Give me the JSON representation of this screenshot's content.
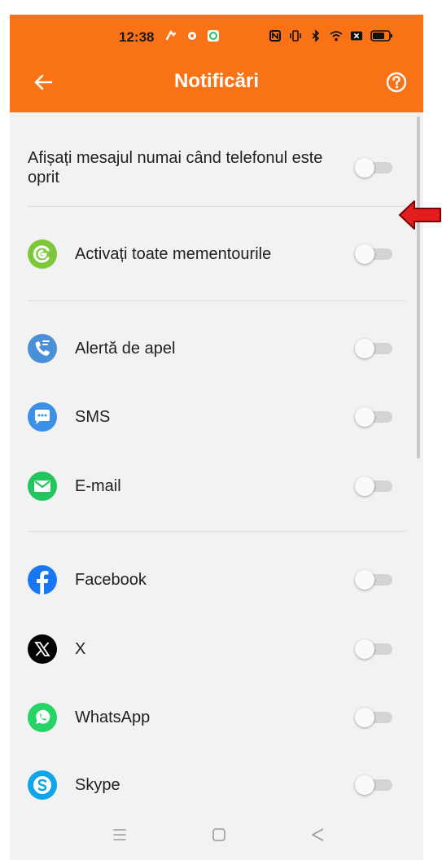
{
  "status_bar": {
    "time": "12:38"
  },
  "toolbar": {
    "title": "Notificări"
  },
  "settings": {
    "screen_off_label": "Afișați mesajul numai când telefonul este oprit",
    "all_reminders_label": "Activați toate mementourile",
    "call_alert_label": "Alertă de apel",
    "sms_label": "SMS",
    "email_label": "E-mail",
    "facebook_label": "Facebook",
    "x_label": "X",
    "whatsapp_label": "WhatsApp",
    "skype_label": "Skype"
  },
  "toggles": {
    "screen_off": false,
    "all_reminders": false,
    "call_alert": false,
    "sms": false,
    "email": false,
    "facebook": false,
    "x": false,
    "whatsapp": false,
    "skype": false
  },
  "colors": {
    "appbar": "#f97316",
    "reminder_icon": "#7cc83a",
    "call_icon": "#4a90d9",
    "sms_icon": "#3d8fe8",
    "email_icon": "#22c55e",
    "facebook_icon": "#1877f2",
    "x_icon": "#000000",
    "whatsapp_icon": "#25d366",
    "skype_icon": "#0ea5e9",
    "annotation_arrow": "#e11d1d"
  },
  "icons": [
    "back-arrow-icon",
    "help-icon",
    "reminder-icon",
    "phone-call-icon",
    "sms-bubble-icon",
    "email-envelope-icon",
    "facebook-icon",
    "x-logo-icon",
    "whatsapp-icon",
    "skype-icon",
    "menu-icon",
    "home-square-icon",
    "back-triangle-icon"
  ]
}
